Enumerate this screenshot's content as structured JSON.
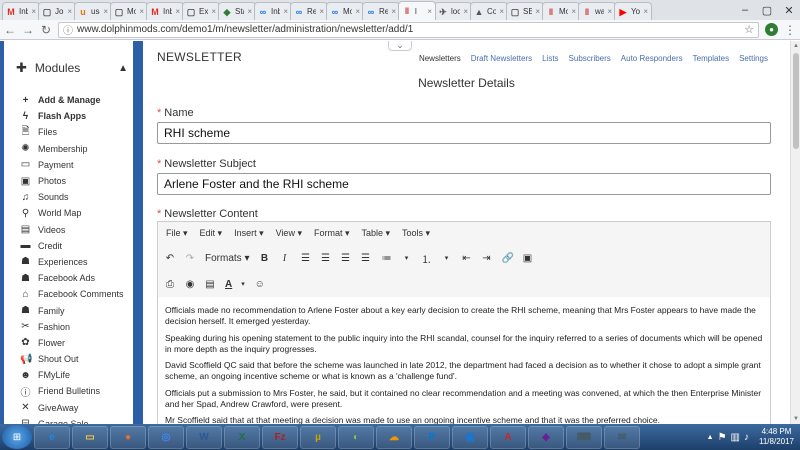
{
  "browser": {
    "tabs": [
      {
        "icon": "M",
        "icon_color": "#d93025",
        "label": "Inbo"
      },
      {
        "icon": "▢",
        "icon_color": "#555555",
        "label": "Join"
      },
      {
        "icon": "u",
        "icon_color": "#e8710a",
        "label": "usa"
      },
      {
        "icon": "▢",
        "icon_color": "#555555",
        "label": "Mo"
      },
      {
        "icon": "M",
        "icon_color": "#d93025",
        "label": "Inbo"
      },
      {
        "icon": "▢",
        "icon_color": "#555555",
        "label": "Expr"
      },
      {
        "icon": "◆",
        "icon_color": "#2e7d32",
        "label": "Star"
      },
      {
        "icon": "∞",
        "icon_color": "#1a73e8",
        "label": "Inbo"
      },
      {
        "icon": "∞",
        "icon_color": "#1a73e8",
        "label": "Rec"
      },
      {
        "icon": "∞",
        "icon_color": "#1a73e8",
        "label": "Mo"
      },
      {
        "icon": "∞",
        "icon_color": "#1a73e8",
        "label": "Rec"
      },
      {
        "icon": "‖",
        "icon_color": "#d32f2f",
        "label": "l"
      },
      {
        "icon": "✈",
        "icon_color": "#555555",
        "label": "look"
      },
      {
        "icon": "▲",
        "icon_color": "#555555",
        "label": "Cou"
      },
      {
        "icon": "▢",
        "icon_color": "#555555",
        "label": "SEM"
      },
      {
        "icon": "‖",
        "icon_color": "#d32f2f",
        "label": "Mo"
      },
      {
        "icon": "‖",
        "icon_color": "#d32f2f",
        "label": "wal"
      },
      {
        "icon": "▶",
        "icon_color": "#ff0000",
        "label": "You"
      }
    ],
    "active_tab": 11,
    "url": "www.dolphinmods.com/demo1/m/newsletter/administration/newsletter/add/1"
  },
  "sidebar": {
    "header": "Modules",
    "items": [
      {
        "icon": "+",
        "label": "Add & Manage",
        "bold": true
      },
      {
        "icon": "ϟ",
        "label": "Flash Apps",
        "bold": true
      },
      {
        "icon": "🗎",
        "label": "Files",
        "bold": false
      },
      {
        "icon": "✺",
        "label": "Membership",
        "bold": false
      },
      {
        "icon": "▭",
        "label": "Payment",
        "bold": false
      },
      {
        "icon": "▣",
        "label": "Photos",
        "bold": false
      },
      {
        "icon": "♫",
        "label": "Sounds",
        "bold": false
      },
      {
        "icon": "⚲",
        "label": "World Map",
        "bold": false
      },
      {
        "icon": "▤",
        "label": "Videos",
        "bold": false
      },
      {
        "icon": "▬",
        "label": "Credit",
        "bold": false
      },
      {
        "icon": "☗",
        "label": "Experiences",
        "bold": false
      },
      {
        "icon": "☗",
        "label": "Facebook Ads",
        "bold": false
      },
      {
        "icon": "⌂",
        "label": "Facebook Comments",
        "bold": false
      },
      {
        "icon": "☗",
        "label": "Family",
        "bold": false
      },
      {
        "icon": "✂",
        "label": "Fashion",
        "bold": false
      },
      {
        "icon": "✿",
        "label": "Flower",
        "bold": false
      },
      {
        "icon": "📢",
        "label": "Shout Out",
        "bold": false
      },
      {
        "icon": "☻",
        "label": "FMyLife",
        "bold": false
      },
      {
        "icon": "ⓘ",
        "label": "Friend Bulletins",
        "bold": false
      },
      {
        "icon": "✕",
        "label": "GiveAway",
        "bold": false
      },
      {
        "icon": "⊟",
        "label": "Garage Sale",
        "bold": false
      }
    ]
  },
  "page": {
    "title": "NEWSLETTER",
    "nav": [
      "Newsletters",
      "Draft Newsletters",
      "Lists",
      "Subscribers",
      "Auto Responders",
      "Templates",
      "Settings"
    ],
    "section_title": "Newsletter Details",
    "name_label": "Name",
    "name_value": "RHI scheme",
    "subject_label": "Newsletter Subject",
    "subject_value": "Arlene Foster and the RHI scheme",
    "content_label": "Newsletter Content"
  },
  "editor": {
    "menus": [
      "File ▾",
      "Edit ▾",
      "Insert ▾",
      "View ▾",
      "Format ▾",
      "Table ▾",
      "Tools ▾"
    ],
    "formats_label": "Formats",
    "paragraphs": [
      "Officials made no recommendation to Arlene Foster about a key early decision to create the RHI scheme, meaning that Mrs Foster appears to have made the decision herself. It emerged yesterday.",
      "Speaking during his opening statement to the public inquiry into the RHI scandal, counsel for the inquiry referred to a series of documents which will be opened in more depth as the inquiry progresses.",
      "David Scoffield QC said that before the scheme was launched in late 2012, the department had faced a decision as to whether it chose to adopt a simple grant scheme, an ongoing incentive scheme or what is known as a 'challenge fund'.",
      "Officials put a submission to Mrs Foster, he said, but it contained no clear recommendation and a meeting was convened, at which the then Enterprise Minister and her Spad, Andrew Crawford, were present.",
      "Mr Scoffield said that at that meeting a decision was made to use an ongoing incentive scheme and that it was the preferred choice."
    ]
  },
  "taskbar": {
    "apps": [
      {
        "icon": "e",
        "color": "#1e88e5"
      },
      {
        "icon": "▭",
        "color": "#f4c542"
      },
      {
        "icon": "●",
        "color": "#e76f2b"
      },
      {
        "icon": "◎",
        "color": "#4285f4"
      },
      {
        "icon": "W",
        "color": "#2b5797"
      },
      {
        "icon": "X",
        "color": "#1e7145"
      },
      {
        "icon": "Fz",
        "color": "#b71c1c"
      },
      {
        "icon": "µ",
        "color": "#c8a000"
      },
      {
        "icon": "◐",
        "color": "#8bc34a"
      },
      {
        "icon": "☁",
        "color": "#f29500"
      },
      {
        "icon": "P",
        "color": "#0078d7"
      },
      {
        "icon": "▣",
        "color": "#1976d2"
      },
      {
        "icon": "A",
        "color": "#c62828"
      },
      {
        "icon": "◈",
        "color": "#6a1b9a"
      },
      {
        "icon": "⌨",
        "color": "#455a64"
      },
      {
        "icon": "✉",
        "color": "#455a64"
      }
    ],
    "time": "4:48 PM",
    "date": "11/8/2017"
  }
}
